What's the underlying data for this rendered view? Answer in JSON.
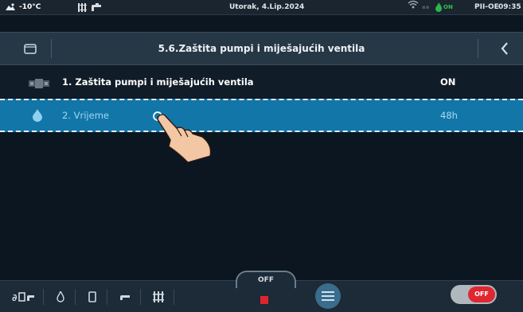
{
  "status_bar": {
    "temperature": "-10°C",
    "date": "Utorak, 4.Lip.2024",
    "flame_status": "ON",
    "mode": "PII-OE",
    "time": "09:35",
    "icons": [
      "outdoor-temperature-icon",
      "radiator-icon",
      "tap-icon",
      "wifi-icon",
      "flame-icon"
    ]
  },
  "header": {
    "title": "5.6.Zaštita pumpi i miješajućih ventila",
    "icons": [
      "home-icon",
      "back-arrow-icon"
    ]
  },
  "items": [
    {
      "label": "1. Zaštita pumpi i miješajućih ventila",
      "value": "ON",
      "icon": "pump-icon"
    },
    {
      "label": "2. Vrijeme",
      "value": "48h",
      "icon": "drop-icon",
      "selected": true
    }
  ],
  "footer": {
    "off_label": "OFF",
    "toggle_label": "OFF",
    "icons": [
      "heating-mode-icon",
      "flame-icon",
      "boiler-icon",
      "tap-icon",
      "radiator-icon",
      "stop-icon",
      "menu-icon"
    ],
    "colors": {
      "stop": "#e0242b",
      "toggle_knob": "#e02630"
    }
  },
  "colors": {
    "selected_row": "#1277a8",
    "background": "#0b1620",
    "header": "#263746"
  }
}
